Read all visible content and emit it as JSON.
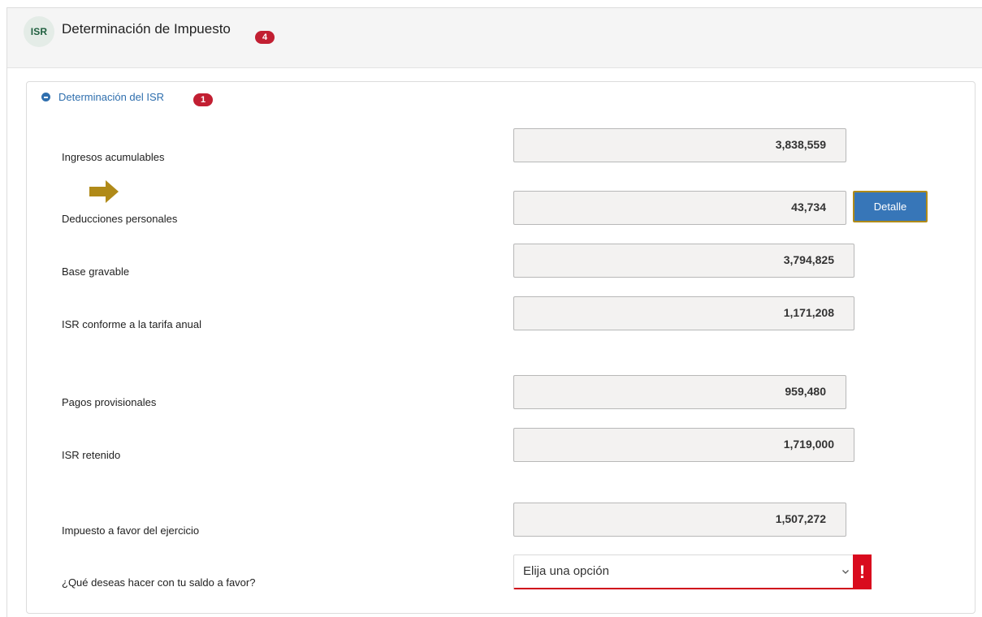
{
  "header": {
    "isr_badge": "ISR",
    "title": "Determinación de Impuesto",
    "count": "4"
  },
  "section": {
    "title": "Determinación del ISR",
    "count": "1"
  },
  "fields": [
    {
      "label": "Ingresos acumulables",
      "value": "3,838,559"
    },
    {
      "label": "Deducciones personales",
      "value": "43,734"
    },
    {
      "label": "Base gravable",
      "value": "3,794,825"
    },
    {
      "label": "ISR conforme a la tarifa anual",
      "value": "1,171,208"
    },
    {
      "label": "Pagos provisionales",
      "value": "959,480"
    },
    {
      "label": "ISR retenido",
      "value": "1,719,000"
    },
    {
      "label": "Impuesto a favor del ejercicio",
      "value": "1,507,272"
    }
  ],
  "detalle_button": "Detalle",
  "saldo": {
    "label": "¿Qué deseas hacer con tu saldo a favor?",
    "selected": "Elija una opción",
    "error_mark": "!"
  },
  "icons": {
    "arrow": "right-arrow-icon",
    "toggle": "minus-circle-icon",
    "dropdown": "chevron-down-icon"
  },
  "colors": {
    "accent_blue": "#2f6fae",
    "badge_red": "#c21f32",
    "arrow_gold": "#b08a18",
    "error_red": "#d90b1e"
  }
}
